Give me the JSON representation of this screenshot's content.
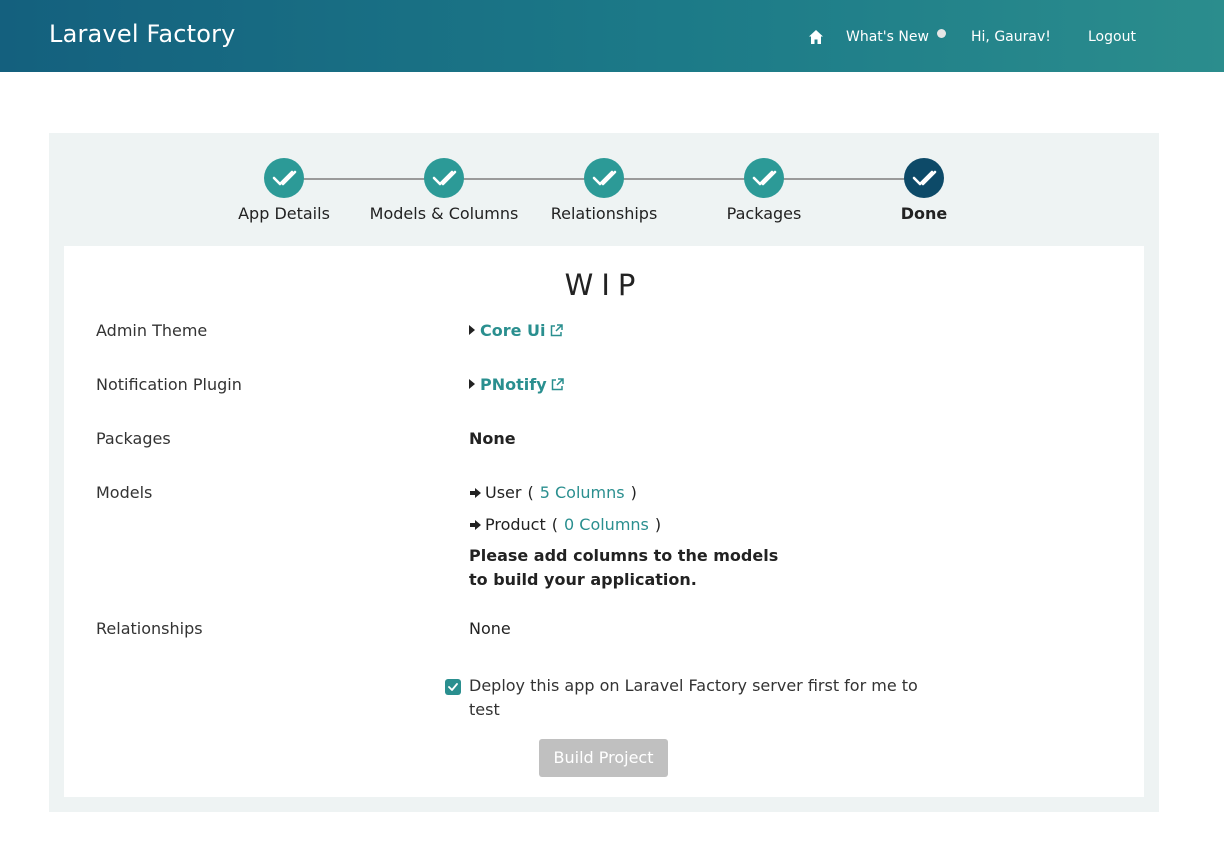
{
  "navbar": {
    "brand": "Laravel Factory",
    "home_icon": "home-icon",
    "whats_new": "What's New",
    "greeting": "Hi, Gaurav!",
    "logout": "Logout",
    "color_start": "#14607e",
    "color_end": "#2b8d8d"
  },
  "stepper": {
    "steps": [
      {
        "label": "App Details",
        "status": "complete"
      },
      {
        "label": "Models & Columns",
        "status": "complete"
      },
      {
        "label": "Relationships",
        "status": "complete"
      },
      {
        "label": "Packages",
        "status": "complete"
      },
      {
        "label": "Done",
        "status": "active"
      }
    ],
    "complete_color": "#2c9a97",
    "active_color": "#0d4a68",
    "icon": "double-check-icon"
  },
  "summary": {
    "title": "WIP",
    "admin_theme_label": "Admin Theme",
    "admin_theme_value": "Core Ui",
    "notification_label": "Notification Plugin",
    "notification_value": "PNotify",
    "packages_label": "Packages",
    "packages_value": "None",
    "models_label": "Models",
    "models": [
      {
        "name": "User",
        "columns": "5 Columns"
      },
      {
        "name": "Product",
        "columns": "0 Columns"
      }
    ],
    "models_warning_line1": "Please add columns to the models",
    "models_warning_line2": "to build your application.",
    "relationships_label": "Relationships",
    "relationships_value": "None",
    "link_color": "#2a8f8f"
  },
  "deploy": {
    "checked": true,
    "label": "Deploy this app on Laravel Factory server first for me to test"
  },
  "build_button": {
    "label": "Build Project",
    "disabled": true
  }
}
